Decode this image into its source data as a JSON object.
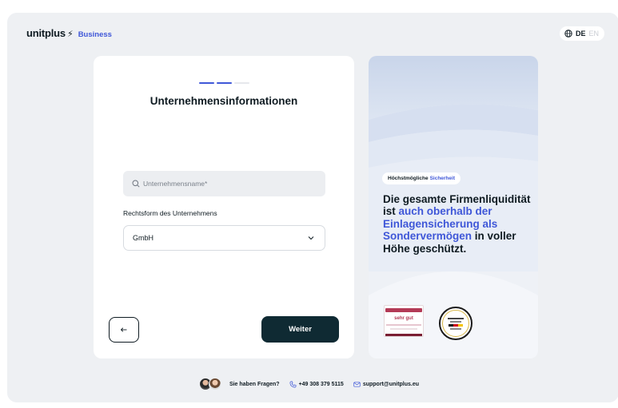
{
  "brand": {
    "name": "unitplus",
    "bolt": "⚡",
    "product": "Business",
    "accent_color": "#3f57d8",
    "dark_color": "#0f2a33"
  },
  "language": {
    "icon": "globe-icon",
    "active": "DE",
    "inactive": "EN"
  },
  "form": {
    "progress": {
      "steps": 3,
      "current": 2
    },
    "title": "Unternehmensinformationen",
    "company_name": {
      "icon": "search-icon",
      "placeholder": "Unternehmensname*",
      "value": ""
    },
    "legal_form": {
      "label": "Rechtsform des Unternehmens",
      "value": "GmbH",
      "icon": "chevron-down-icon"
    },
    "back_button": {
      "icon": "arrow-left-icon"
    },
    "next_button": {
      "label": "Weiter"
    }
  },
  "promo": {
    "badge_text": "Höchstmögliche",
    "badge_accent": "Sicherheit",
    "headline_1": "Die gesamte Firmenliquidität ist ",
    "headline_accent_1": "auch oberhalb der Einlagensicherung als Sondervermögen",
    "headline_2": " in voller Höhe geschützt.",
    "seal_1_rating": "sehr gut",
    "seals": [
      "award-seal",
      "award-seal-round"
    ]
  },
  "footer": {
    "question": "Sie haben Fragen?",
    "phone": "+49 308 379 5115",
    "email": "support@unitplus.eu",
    "phone_icon": "phone-icon",
    "mail_icon": "mail-icon"
  }
}
